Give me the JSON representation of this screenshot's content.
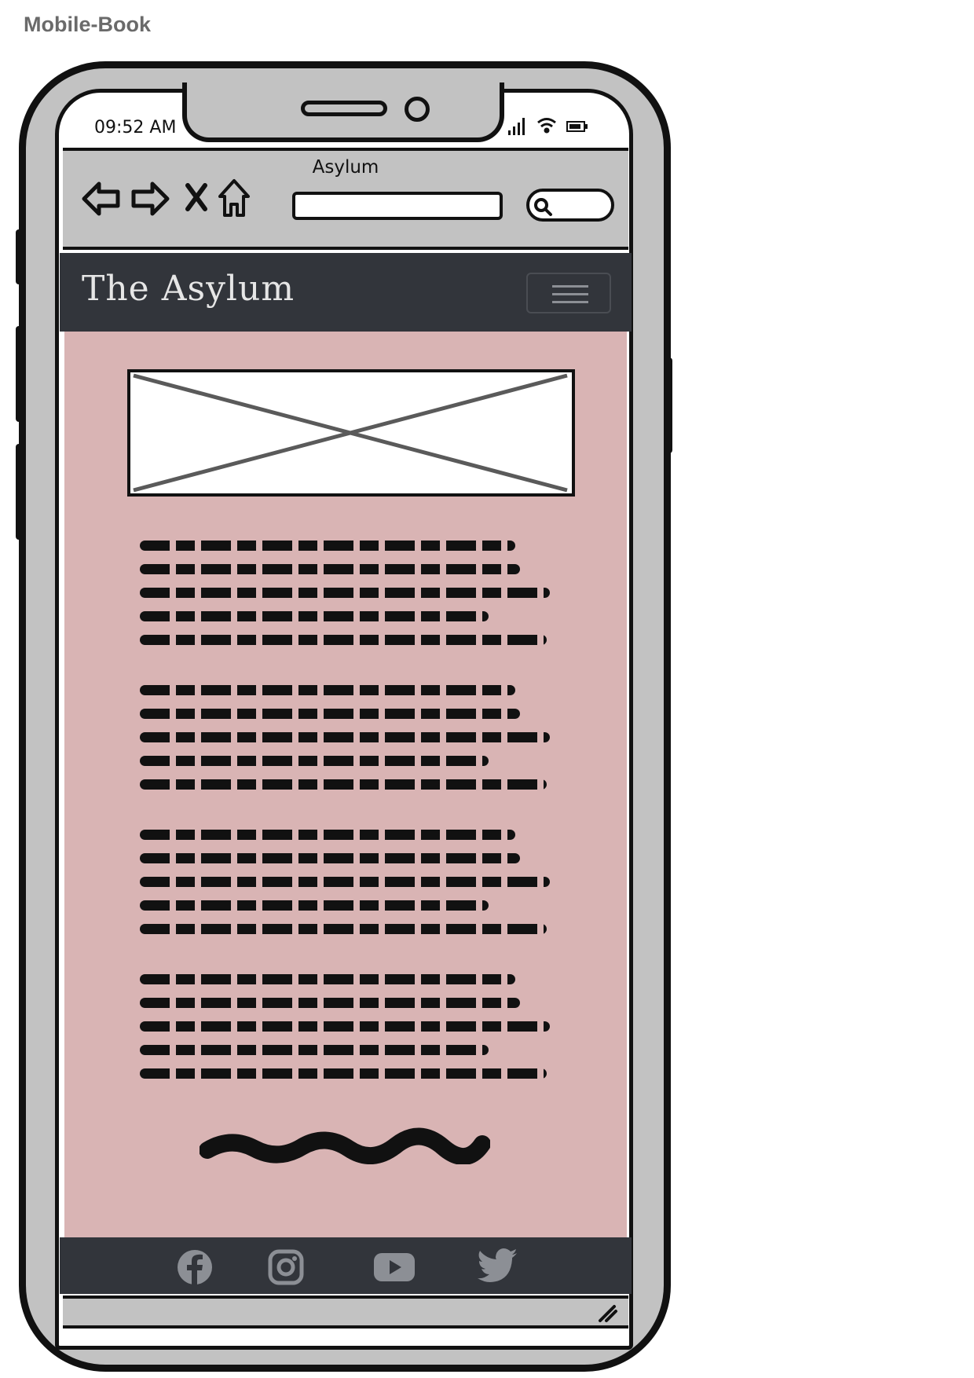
{
  "page_label": "Mobile-Book",
  "status_bar": {
    "time": "09:52 AM"
  },
  "browser": {
    "title": "Asylum",
    "url_value": "",
    "search_value": ""
  },
  "site": {
    "brand": "The Asylum",
    "footer_links": [
      "facebook-icon",
      "instagram-icon",
      "youtube-icon",
      "twitter-icon"
    ]
  },
  "colors": {
    "content_background": "#d9b4b4",
    "header_background": "#32353b",
    "device_frame": "#c2c2c2"
  }
}
